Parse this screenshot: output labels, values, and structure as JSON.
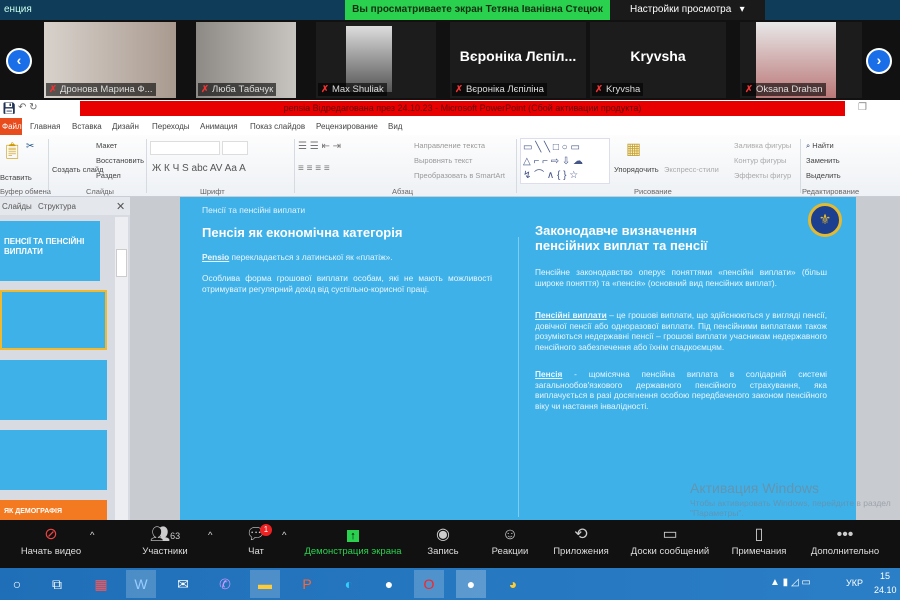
{
  "zoom_top": {
    "app_title": "енция",
    "share_banner": "Вы просматриваете экран Тетяна Іванівна Стецюк",
    "view_options": "Настройки просмотра"
  },
  "participants": [
    {
      "name": "Дронова Марина Ф..."
    },
    {
      "name": "Люба Табачук"
    },
    {
      "name": "Max Shuliak"
    },
    {
      "name": "Вєроніка Лєпіліна",
      "display": "Вєроніка Лєпіл..."
    },
    {
      "name": "Kryvsha",
      "display": "Kryvsha"
    },
    {
      "name": "Oksana Drahan"
    }
  ],
  "ppt": {
    "title": "pensia Відредагована през 24.10.23 - Microsoft PowerPoint (Сбой активации продукта)",
    "tabs": [
      "Файл",
      "Главная",
      "Вставка",
      "Дизайн",
      "Переходы",
      "Анимация",
      "Показ слайдов",
      "Рецензирование",
      "Вид"
    ],
    "ribbon": {
      "clipboard": {
        "paste": "Вставить",
        "group": "Буфер обмена"
      },
      "slides": {
        "create": "Создать слайд",
        "layout": "Макет",
        "reset": "Восстановить",
        "section": "Раздел",
        "group": "Слайды"
      },
      "font": {
        "group": "Шрифт"
      },
      "paragraph": {
        "text_dir": "Направление текста",
        "align": "Выровнять текст",
        "smartart": "Преобразовать в SmartArt",
        "group": "Абзац"
      },
      "drawing": {
        "arrange": "Упорядочить",
        "styles": "Экспресс-стили",
        "fill": "Заливка фигуры",
        "outline": "Контур фигуры",
        "effects": "Эффекты фигур",
        "group": "Рисование"
      },
      "editing": {
        "find": "Найти",
        "replace": "Заменить",
        "select": "Выделить",
        "group": "Редактирование"
      }
    },
    "panel_tabs": [
      "Слайды",
      "Структура"
    ],
    "thumbnails": [
      {
        "title": "ПЕНСІЇ ТА ПЕНСІЙНІ ВИПЛАТИ"
      },
      {
        "title": ""
      },
      {
        "title": ""
      },
      {
        "title": ""
      },
      {
        "title": "ЯК ДЕМОГРАФІЯ"
      }
    ]
  },
  "slide": {
    "header": "Пенсії та пенсійні виплати",
    "left_title": "Пенсія як економічна категорія",
    "left_p1_term": "Pensio",
    "left_p1_rest": " перекладається з латинської як «платіж».",
    "left_p2": "Особлива форма грошової виплати особам, які не мають можливості отримувати регулярний дохід від суспільно-корисної праці.",
    "right_title": "Законодавче визначення пенсійних виплат та пенсії",
    "right_p1": "Пенсійне законодавство оперує поняттями «пенсійні виплати» (більш широке поняття) та «пенсія» (основний вид пенсійних виплат).",
    "right_p2_term": "Пенсійні виплати",
    "right_p2_rest": " – це грошові виплати, що здійснюються у вигляді пенсії, довічної пенсії або одноразової виплати. Під пенсійними виплатами також розуміються недержавні пенсії – грошові виплати учасникам недержавного пенсійного забезпечення або їхнім спадкоємцям.",
    "right_p3_term": "Пенсія",
    "right_p3_rest": " - щомісячна пенсійна виплата в солідарній системі загальнообов'язкового державного пенсійного страхування, яка виплачується в разі досягнення особою передбаченого законом пенсійного віку чи настання інвалідності."
  },
  "watermark": {
    "line1": "Активация Windows",
    "line2": "Чтобы активировать Windows, перейдите в раздел \"Параметры\"."
  },
  "zoom_toolbar": {
    "video": "Начать видео",
    "participants": "Участники",
    "participants_count": "63",
    "chat": "Чат",
    "chat_badge": "1",
    "share": "Демонстрация экрана",
    "record": "Запись",
    "reactions": "Реакции",
    "apps": "Приложения",
    "whiteboards": "Доски сообщений",
    "notes": "Примечания",
    "more": "Дополнительно"
  },
  "taskbar": {
    "lang": "УКР",
    "time": "15",
    "date": "24.10"
  },
  "colors": {
    "slide_bg": "#3fb1e9",
    "share_green": "#2ad14f",
    "title_red": "#e80000"
  }
}
